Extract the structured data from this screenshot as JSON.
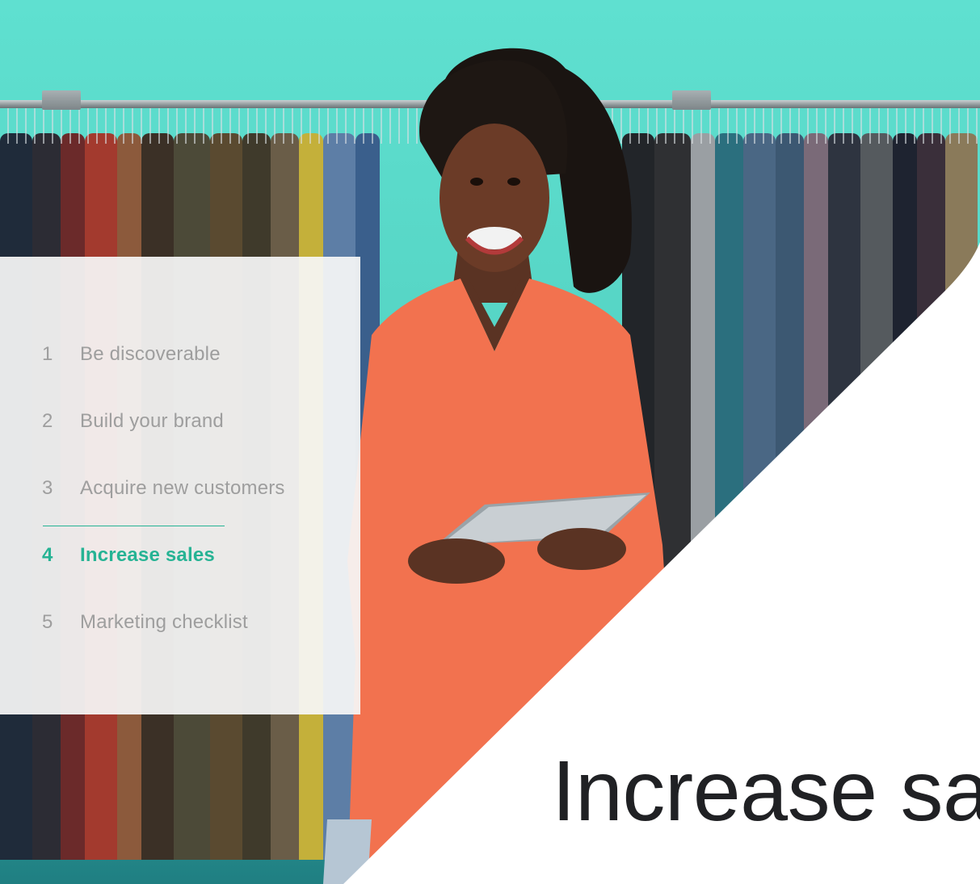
{
  "nav": {
    "items": [
      {
        "number": "1",
        "label": "Be discoverable",
        "active": false
      },
      {
        "number": "2",
        "label": "Build your brand",
        "active": false
      },
      {
        "number": "3",
        "label": "Acquire new customers",
        "active": false
      },
      {
        "number": "4",
        "label": "Increase sales",
        "active": true
      },
      {
        "number": "5",
        "label": "Marketing checklist",
        "active": false
      }
    ]
  },
  "hero": {
    "title": "Increase sa"
  },
  "colors": {
    "accent": "#26b394",
    "wall": "#5ed9c8",
    "shirt": "#f2724f",
    "text_muted": "#9e9e9e",
    "title": "#202124"
  }
}
